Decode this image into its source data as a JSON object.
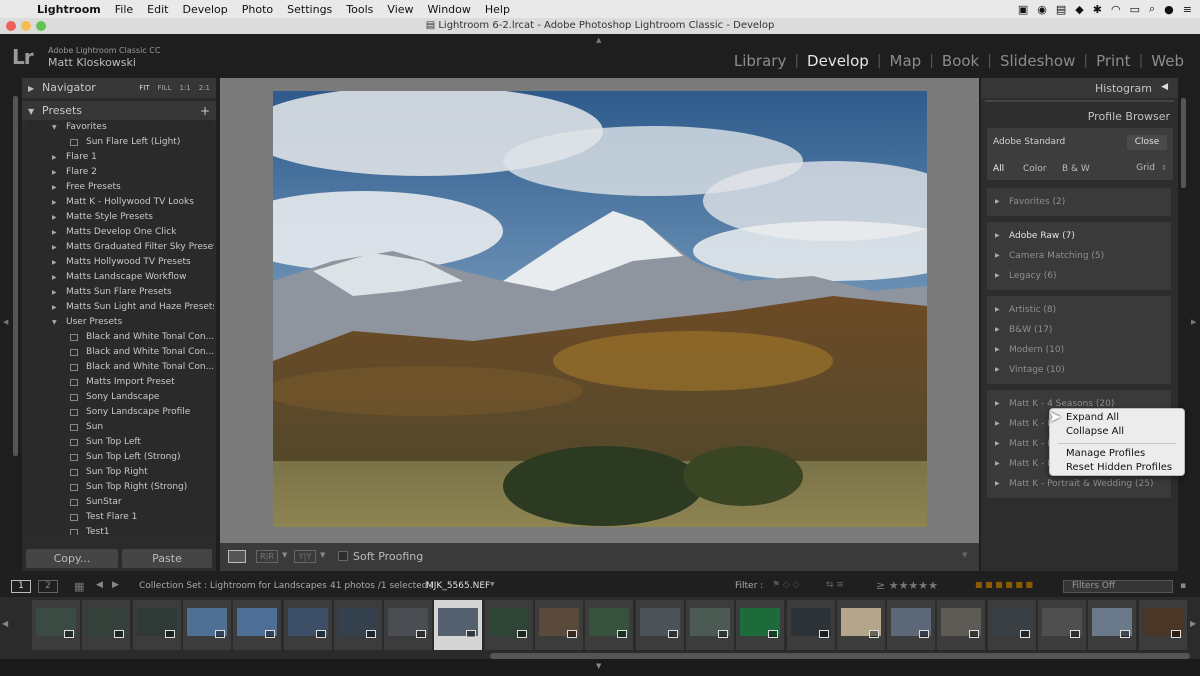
{
  "menubar": {
    "app": "Lightroom",
    "items": [
      "File",
      "Edit",
      "Develop",
      "Photo",
      "Settings",
      "Tools",
      "View",
      "Window",
      "Help"
    ]
  },
  "window": {
    "title": "Lightroom 6-2.lrcat - Adobe Photoshop Lightroom Classic - Develop"
  },
  "identity": {
    "logo": "Lr",
    "product": "Adobe Lightroom Classic CC",
    "user": "Matt Kloskowski"
  },
  "modules": [
    "Library",
    "Develop",
    "Map",
    "Book",
    "Slideshow",
    "Print",
    "Web"
  ],
  "active_module": "Develop",
  "left_panel": {
    "navigator_label": "Navigator",
    "zoom": [
      "FIT",
      "FILL",
      "1:1",
      "2:1"
    ],
    "presets_label": "Presets",
    "add_icon": "plus-icon",
    "presets": [
      {
        "label": "Favorites",
        "level": 0,
        "kind": "open"
      },
      {
        "label": "Sun Flare Left (Light)",
        "level": 1,
        "kind": "preset"
      },
      {
        "label": "Flare 1",
        "level": 0,
        "kind": "closed"
      },
      {
        "label": "Flare 2",
        "level": 0,
        "kind": "closed"
      },
      {
        "label": "Free Presets",
        "level": 0,
        "kind": "closed"
      },
      {
        "label": "Matt K - Hollywood TV Looks",
        "level": 0,
        "kind": "closed"
      },
      {
        "label": "Matte Style Presets",
        "level": 0,
        "kind": "closed"
      },
      {
        "label": "Matts Develop One Click",
        "level": 0,
        "kind": "closed"
      },
      {
        "label": "Matts Graduated Filter Sky Presets",
        "level": 0,
        "kind": "closed"
      },
      {
        "label": "Matts Hollywood TV Presets",
        "level": 0,
        "kind": "closed"
      },
      {
        "label": "Matts Landscape Workflow",
        "level": 0,
        "kind": "closed"
      },
      {
        "label": "Matts Sun Flare Presets",
        "level": 0,
        "kind": "closed"
      },
      {
        "label": "Matts Sun Light and Haze Presets",
        "level": 0,
        "kind": "closed"
      },
      {
        "label": "User Presets",
        "level": 0,
        "kind": "open"
      },
      {
        "label": "Black and White Tonal Con...",
        "level": 1,
        "kind": "preset"
      },
      {
        "label": "Black and White Tonal Con...",
        "level": 1,
        "kind": "preset"
      },
      {
        "label": "Black and White Tonal Con...",
        "level": 1,
        "kind": "preset"
      },
      {
        "label": "Matts Import Preset",
        "level": 1,
        "kind": "preset"
      },
      {
        "label": "Sony Landscape",
        "level": 1,
        "kind": "preset"
      },
      {
        "label": "Sony Landscape Profile",
        "level": 1,
        "kind": "preset"
      },
      {
        "label": "Sun",
        "level": 1,
        "kind": "preset"
      },
      {
        "label": "Sun Top Left",
        "level": 1,
        "kind": "preset"
      },
      {
        "label": "Sun Top Left (Strong)",
        "level": 1,
        "kind": "preset"
      },
      {
        "label": "Sun Top Right",
        "level": 1,
        "kind": "preset"
      },
      {
        "label": "Sun Top Right (Strong)",
        "level": 1,
        "kind": "preset"
      },
      {
        "label": "SunStar",
        "level": 1,
        "kind": "preset"
      },
      {
        "label": "Test Flare 1",
        "level": 1,
        "kind": "preset"
      },
      {
        "label": "Test1",
        "level": 1,
        "kind": "preset"
      }
    ],
    "copy_label": "Copy...",
    "paste_label": "Paste"
  },
  "toolbar": {
    "view_modes": [
      "R|R",
      "Y|Y"
    ],
    "soft_proofing": "Soft Proofing"
  },
  "right_panel": {
    "histogram_label": "Histogram",
    "profile_browser_label": "Profile Browser",
    "current_profile": "Adobe Standard",
    "close_label": "Close",
    "filters": [
      "All",
      "Color",
      "B & W"
    ],
    "view_label": "Grid",
    "groups": [
      [
        {
          "label": "Favorites (2)",
          "bold": false
        }
      ],
      [
        {
          "label": "Adobe Raw (7)",
          "bold": true
        },
        {
          "label": "Camera Matching (5)",
          "bold": false
        },
        {
          "label": "Legacy (6)",
          "bold": false
        }
      ],
      [
        {
          "label": "Artistic (8)",
          "bold": false
        },
        {
          "label": "B&W (17)",
          "bold": false
        },
        {
          "label": "Modern (10)",
          "bold": false
        },
        {
          "label": "Vintage (10)",
          "bold": false
        }
      ],
      [
        {
          "label": "Matt K - 4 Seasons (20)",
          "bold": false
        },
        {
          "label": "Matt K - B",
          "bold": false
        },
        {
          "label": "Matt K - F",
          "bold": false
        },
        {
          "label": "Matt K - L",
          "bold": false
        },
        {
          "label": "Matt K - Portrait & Wedding (25)",
          "bold": false
        }
      ]
    ]
  },
  "context_menu": [
    "Expand All",
    "Collapse All",
    "Manage Profiles",
    "Reset Hidden Profiles"
  ],
  "filter_bar": {
    "pages": [
      "1",
      "2"
    ],
    "source": "Collection Set : Lightroom for Landscapes",
    "count": "41 photos /1 selected /",
    "filename": "MJK_5565.NEF",
    "filter_label": "Filter :",
    "filters_off": "Filters Off"
  },
  "filmstrip": {
    "selected_index": 8,
    "thumb_colors": [
      "#3c4a44",
      "#34403a",
      "#2f3a36",
      "#4f6f93",
      "#4d6f96",
      "#3c4f66",
      "#34404c",
      "#4a4e52",
      "#55606e",
      "#2e4436",
      "#5a4a3c",
      "#36513c",
      "#4b5258",
      "#4c5a54",
      "#1d6b3a",
      "#2c3236",
      "#b3a68a",
      "#5c6878",
      "#5e5a56",
      "#3a3f44",
      "#4f4f4f",
      "#6a7a8a",
      "#4a3626"
    ]
  }
}
